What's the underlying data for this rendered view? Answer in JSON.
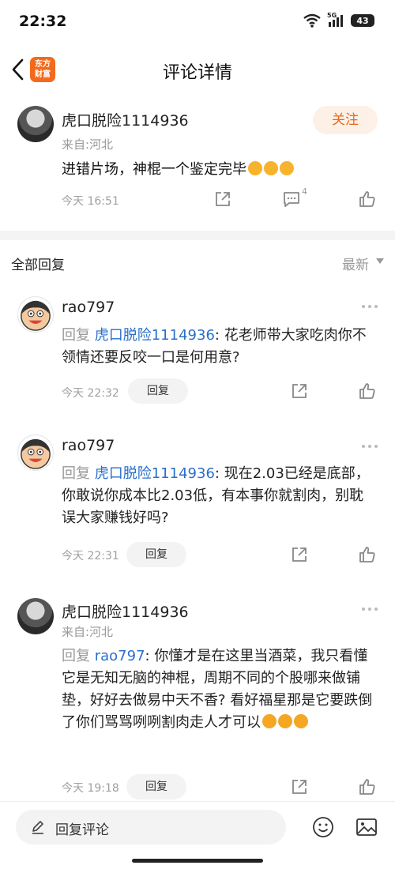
{
  "status_bar": {
    "time": "22:32",
    "network": "5G",
    "battery": "43"
  },
  "nav": {
    "logo_line1": "东方",
    "logo_line2": "财富",
    "title": "评论详情"
  },
  "post": {
    "username": "虎口脱险1114936",
    "location": "来自:河北",
    "text": "进错片场，神棍一个鉴定完毕",
    "emoji_count": 3,
    "follow_label": "关注",
    "time": "今天 16:51",
    "comment_count": "4"
  },
  "section": {
    "title": "全部回复",
    "sort": "最新"
  },
  "replies": [
    {
      "username": "rao797",
      "reply_prefix": "回复",
      "reply_target": "虎口脱险1114936",
      "text": ": 花老师带大家吃肉你不领情还要反咬一口是何用意?",
      "time": "今天 22:32",
      "reply_button": "回复"
    },
    {
      "username": "rao797",
      "reply_prefix": "回复",
      "reply_target": "虎口脱险1114936",
      "text": ": 现在2.03已经是底部，你敢说你成本比2.03低，有本事你就割肉，别耽误大家赚钱好吗?",
      "time": "今天 22:31",
      "reply_button": "回复"
    },
    {
      "username": "虎口脱险1114936",
      "location": "来自:河北",
      "reply_prefix": "回复",
      "reply_target": "rao797",
      "text": ": 你懂才是在这里当酒菜，我只看懂它是无知无脑的神棍，周期不同的个股哪来做铺垫，好好去做易中天不香? 看好福星那是它要跌倒了你们骂骂咧咧割肉走人才可以",
      "time": "今天 19:18",
      "reply_button": "回复"
    }
  ],
  "bottom": {
    "input_placeholder": "回复评论"
  },
  "colors": {
    "accent": "#e86a1e",
    "link": "#2a6fc9",
    "muted": "#999999"
  }
}
